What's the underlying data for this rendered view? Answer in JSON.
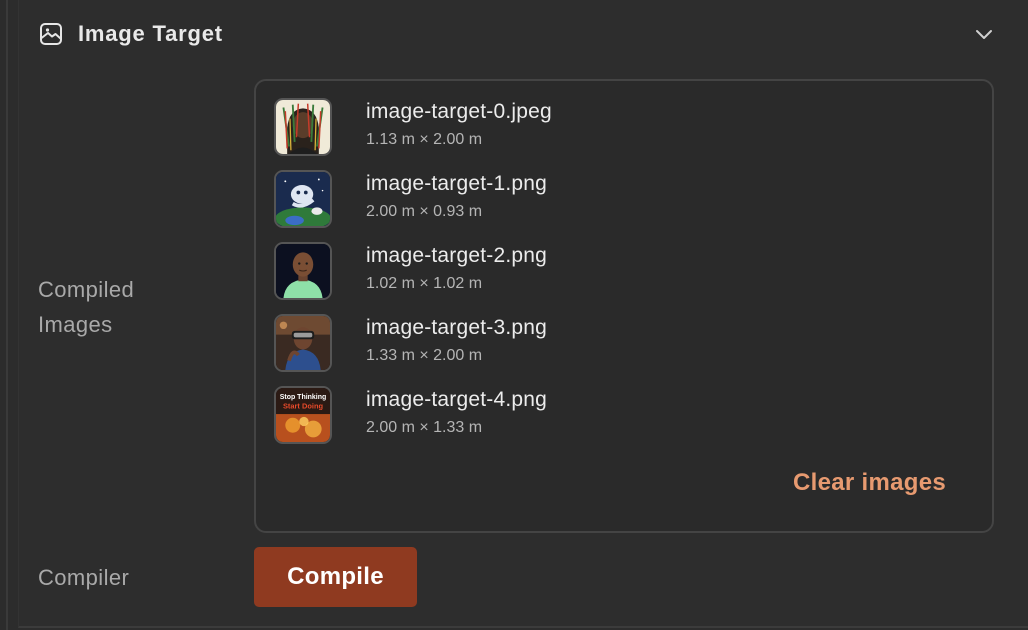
{
  "section": {
    "title": "Image Target",
    "icon": "image-icon",
    "expand_icon": "chevron-down-icon"
  },
  "compiled_images": {
    "label_line1": "Compiled",
    "label_line2": "Images",
    "items": [
      {
        "name": "image-target-0.jpeg",
        "size": "1.13 m × 2.00 m"
      },
      {
        "name": "image-target-1.png",
        "size": "2.00 m × 0.93 m"
      },
      {
        "name": "image-target-2.png",
        "size": "1.02 m × 1.02 m"
      },
      {
        "name": "image-target-3.png",
        "size": "1.33 m × 2.00 m"
      },
      {
        "name": "image-target-4.png",
        "size": "2.00 m × 1.33 m"
      }
    ],
    "clear_label": "Clear images",
    "thumb4_text_line1": "Stop Thinking",
    "thumb4_text_line2": "Start Doing"
  },
  "compiler": {
    "label": "Compiler",
    "button_label": "Compile"
  },
  "colors": {
    "background": "#2c2c2c",
    "accent_text": "#e79a70",
    "button_bg": "#8f3a20"
  }
}
